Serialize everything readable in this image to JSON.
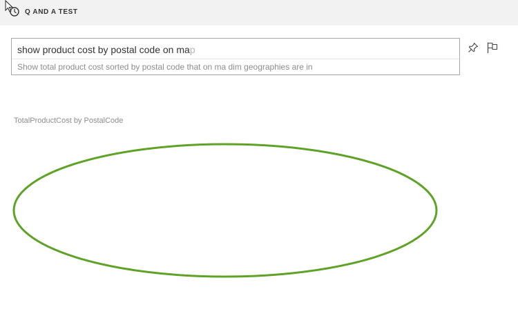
{
  "header": {
    "title": "Q AND A TEST",
    "cursor_icon": "mouse-cursor-icon"
  },
  "qa": {
    "typed_text": "show product cost by postal code on ma",
    "completion_text": "p",
    "suggestion": "Show total product cost sorted by postal code that on ma dim geographies are in"
  },
  "toolbar": {
    "pin_icon": "pin-icon",
    "flag_icon": "flag-icon"
  },
  "visual": {
    "title": "TotalProductCost by PostalCode",
    "accent_color": "#5ea226"
  }
}
